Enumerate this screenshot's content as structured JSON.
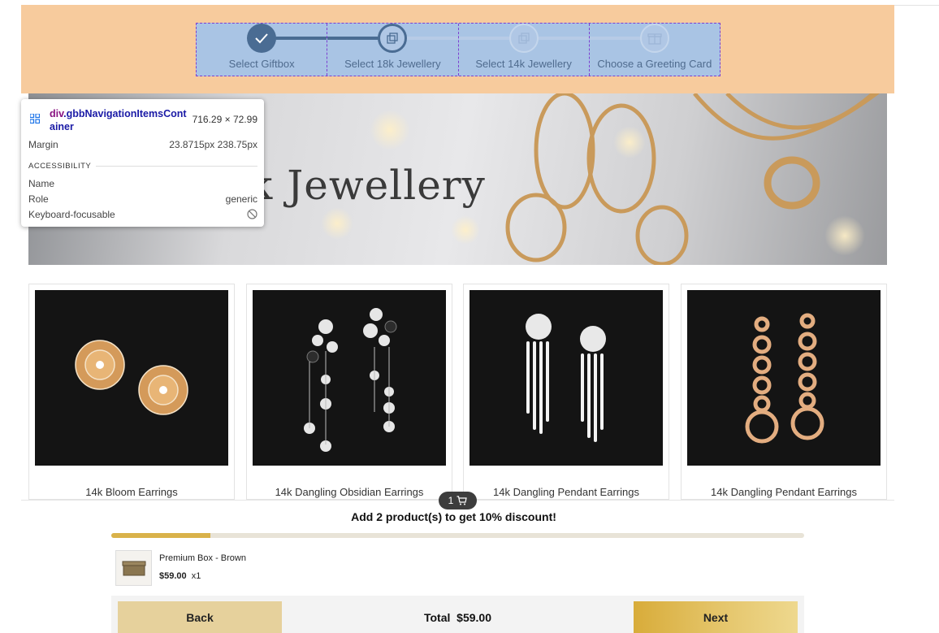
{
  "nav": {
    "steps": [
      {
        "label": "Select Giftbox",
        "state": "done",
        "icon": "check-icon"
      },
      {
        "label": "Select 18k Jewellery",
        "state": "active",
        "icon": "stack-icon"
      },
      {
        "label": "Select 14k Jewellery",
        "state": "todo",
        "icon": "stack-icon"
      },
      {
        "label": "Choose a Greeting Card",
        "state": "todo",
        "icon": "gift-icon"
      }
    ]
  },
  "inspector": {
    "tag": "div",
    "class_name": ".gbbNavigationItemsContainer",
    "dimensions": "716.29 × 72.99",
    "margin_label": "Margin",
    "margin_value": "23.8715px 238.75px",
    "section": "ACCESSIBILITY",
    "name_label": "Name",
    "name_value": "",
    "role_label": "Role",
    "role_value": "generic",
    "focusable_label": "Keyboard-focusable",
    "focusable_icon": "not-allowed-icon"
  },
  "banner": {
    "title": "k Jewellery"
  },
  "products": [
    {
      "name": "14k Bloom Earrings"
    },
    {
      "name": "14k Dangling Obsidian Earrings"
    },
    {
      "name": "14k Dangling Pendant Earrings"
    },
    {
      "name": "14k Dangling Pendant Earrings"
    }
  ],
  "cart": {
    "count": "1",
    "icon": "cart-icon"
  },
  "discount_message": "Add 2 product(s) to get 10% discount!",
  "progress_fraction": 0.143,
  "selected_box": {
    "name": "Premium Box - Brown",
    "price": "$59.00",
    "qty": "x1"
  },
  "footer": {
    "back_label": "Back",
    "total_label": "Total",
    "total_value": "$59.00",
    "next_label": "Next"
  },
  "colors": {
    "header_bg": "#f7cb9d",
    "highlight": "#a9c4e4",
    "step_done": "#4a6c93",
    "progress": "#d9b24a",
    "next_button": "#d8ac3a",
    "back_button": "#e6d19c"
  }
}
